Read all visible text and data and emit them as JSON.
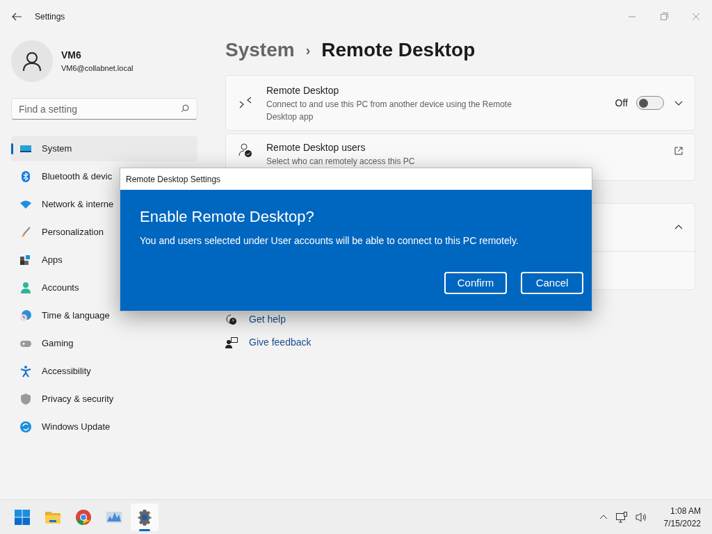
{
  "window": {
    "title": "Settings"
  },
  "account": {
    "name": "VM6",
    "email": "VM6@collabnet.local"
  },
  "search": {
    "placeholder": "Find a setting"
  },
  "sidebar": {
    "items": [
      {
        "label": "System",
        "kind": "system",
        "selected": true
      },
      {
        "label": "Bluetooth & devic",
        "kind": "bluetooth",
        "selected": false
      },
      {
        "label": "Network & interne",
        "kind": "network",
        "selected": false
      },
      {
        "label": "Personalization",
        "kind": "brush",
        "selected": false
      },
      {
        "label": "Apps",
        "kind": "apps",
        "selected": false
      },
      {
        "label": "Accounts",
        "kind": "accounts",
        "selected": false
      },
      {
        "label": "Time & language",
        "kind": "time",
        "selected": false
      },
      {
        "label": "Gaming",
        "kind": "gaming",
        "selected": false
      },
      {
        "label": "Accessibility",
        "kind": "accessibility",
        "selected": false
      },
      {
        "label": "Privacy & security",
        "kind": "privacy",
        "selected": false
      },
      {
        "label": "Windows Update",
        "kind": "update",
        "selected": false
      }
    ]
  },
  "breadcrumb": {
    "parent": "System",
    "separator": "›",
    "current": "Remote Desktop"
  },
  "cards": [
    {
      "kind": "toggle",
      "title": "Remote Desktop",
      "subtitle": "Connect to and use this PC from another device using the Remote Desktop app",
      "state_label": "Off",
      "on": false
    },
    {
      "kind": "link",
      "title": "Remote Desktop users",
      "subtitle": "Select who can remotely access this PC"
    },
    {
      "kind": "expander",
      "expanded": true
    }
  ],
  "help_links": [
    {
      "label": "Get help",
      "kind": "help"
    },
    {
      "label": "Give feedback",
      "kind": "feedback"
    }
  ],
  "dialog": {
    "title": "Remote Desktop Settings",
    "heading": "Enable Remote Desktop?",
    "message": "You and users selected under User accounts will be able to connect to this PC remotely.",
    "buttons": [
      "Confirm",
      "Cancel"
    ]
  },
  "taskbar": {
    "apps": [
      {
        "kind": "start",
        "active": false
      },
      {
        "kind": "explorer",
        "active": false
      },
      {
        "kind": "chrome",
        "active": false
      },
      {
        "kind": "monitor",
        "active": false
      },
      {
        "kind": "settings",
        "active": true
      }
    ],
    "time": "1:08 AM",
    "date": "7/15/2022"
  }
}
